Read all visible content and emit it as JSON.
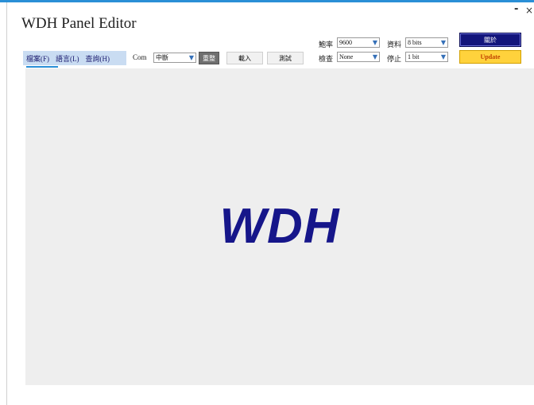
{
  "window": {
    "title": "WDH Panel Editor",
    "minimize_glyph": "-",
    "close_glyph": "×"
  },
  "menu": {
    "items": [
      {
        "label": "檔案(F)"
      },
      {
        "label": "語言(L)"
      },
      {
        "label": "查詢(H)"
      }
    ]
  },
  "toolbar": {
    "com_label": "Com",
    "com_value": "中斷",
    "reset_label": "重整",
    "load_label": "載入",
    "test_label": "測試",
    "baud_label": "鮑率",
    "baud_value": "9600",
    "parity_label": "檢查",
    "parity_value": "None",
    "data_label": "資料",
    "data_value": "8 bits",
    "stop_label": "停止",
    "stop_value": "1 bit",
    "close_button_label": "關於",
    "update_button_label": "Update"
  },
  "canvas": {
    "logo_text": "WDH",
    "logo_color": "#16168a",
    "background": "#eeeeee"
  },
  "colors": {
    "accent": "#2a8fd6",
    "menubar": "#c9dcf2",
    "navy_button": "#13157c",
    "update_button": "#ffd23c"
  }
}
